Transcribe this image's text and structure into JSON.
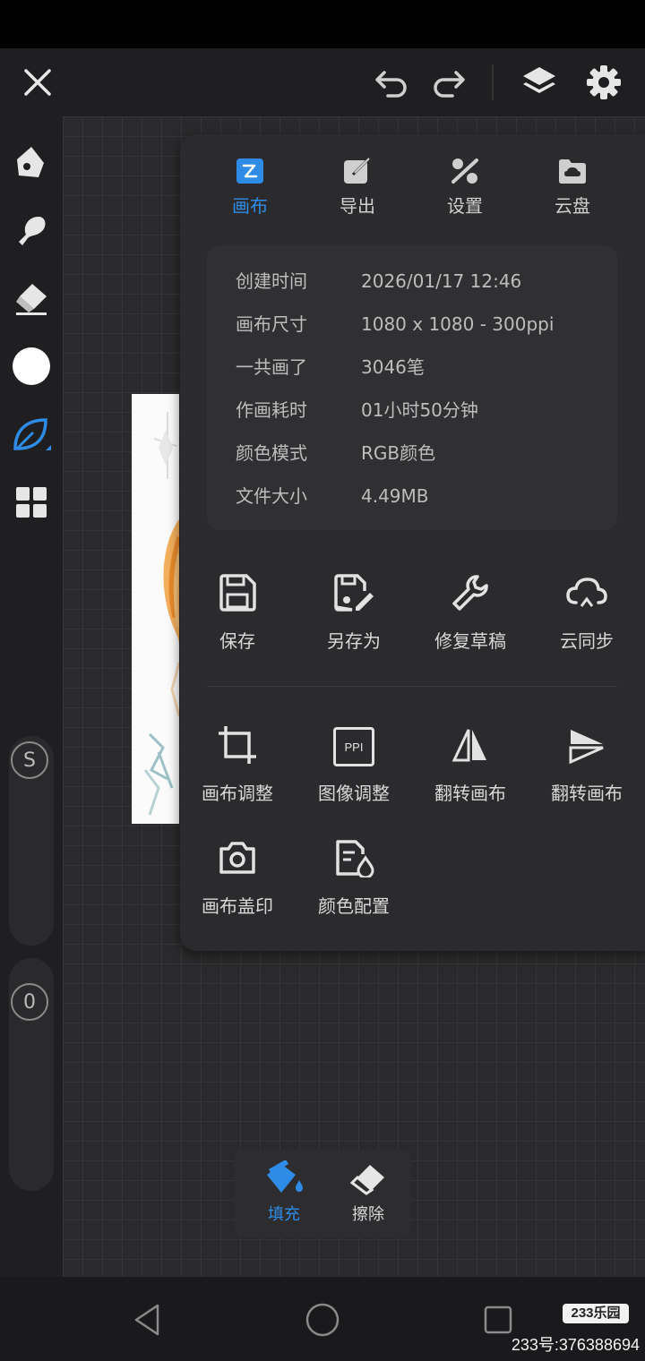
{
  "colors": {
    "accent": "#2f8ce6",
    "panel": "#2b2b2d"
  },
  "topbar": {
    "icons": [
      "close-icon",
      "undo-icon",
      "redo-icon",
      "layers-icon",
      "gear-icon"
    ]
  },
  "tabs": [
    {
      "label": "画布",
      "icon": "canvas-icon",
      "active": true
    },
    {
      "label": "导出",
      "icon": "export-icon",
      "active": false
    },
    {
      "label": "设置",
      "icon": "settings-icon",
      "active": false
    },
    {
      "label": "云盘",
      "icon": "cloud-drive-icon",
      "active": false
    }
  ],
  "info": [
    {
      "key": "创建时间",
      "value": "2026/01/17 12:46"
    },
    {
      "key": "画布尺寸",
      "value": "1080 x 1080 - 300ppi"
    },
    {
      "key": "一共画了",
      "value": "3046笔"
    },
    {
      "key": "作画耗时",
      "value": "01小时50分钟"
    },
    {
      "key": "颜色模式",
      "value": "RGB颜色"
    },
    {
      "key": "文件大小",
      "value": "4.49MB"
    }
  ],
  "actions_row1": [
    {
      "label": "保存",
      "icon": "save-icon"
    },
    {
      "label": "另存为",
      "icon": "save-as-icon"
    },
    {
      "label": "修复草稿",
      "icon": "wrench-icon"
    },
    {
      "label": "云同步",
      "icon": "cloud-sync-icon"
    }
  ],
  "actions_row2": [
    {
      "label": "画布调整",
      "icon": "crop-icon"
    },
    {
      "label": "图像调整",
      "icon": "ppi-icon",
      "badge": "PPI"
    },
    {
      "label": "翻转画布",
      "icon": "flip-horizontal-icon"
    },
    {
      "label": "翻转画布",
      "icon": "flip-vertical-icon"
    }
  ],
  "actions_row3": [
    {
      "label": "画布盖印",
      "icon": "camera-icon"
    },
    {
      "label": "颜色配置",
      "icon": "color-config-icon"
    }
  ],
  "sliders": {
    "size_label": "S",
    "opacity_label": "0"
  },
  "fill_popup": {
    "fill_label": "填充",
    "erase_label": "擦除"
  },
  "watermark": {
    "brand": "233乐园",
    "id": "233号:376388694"
  }
}
